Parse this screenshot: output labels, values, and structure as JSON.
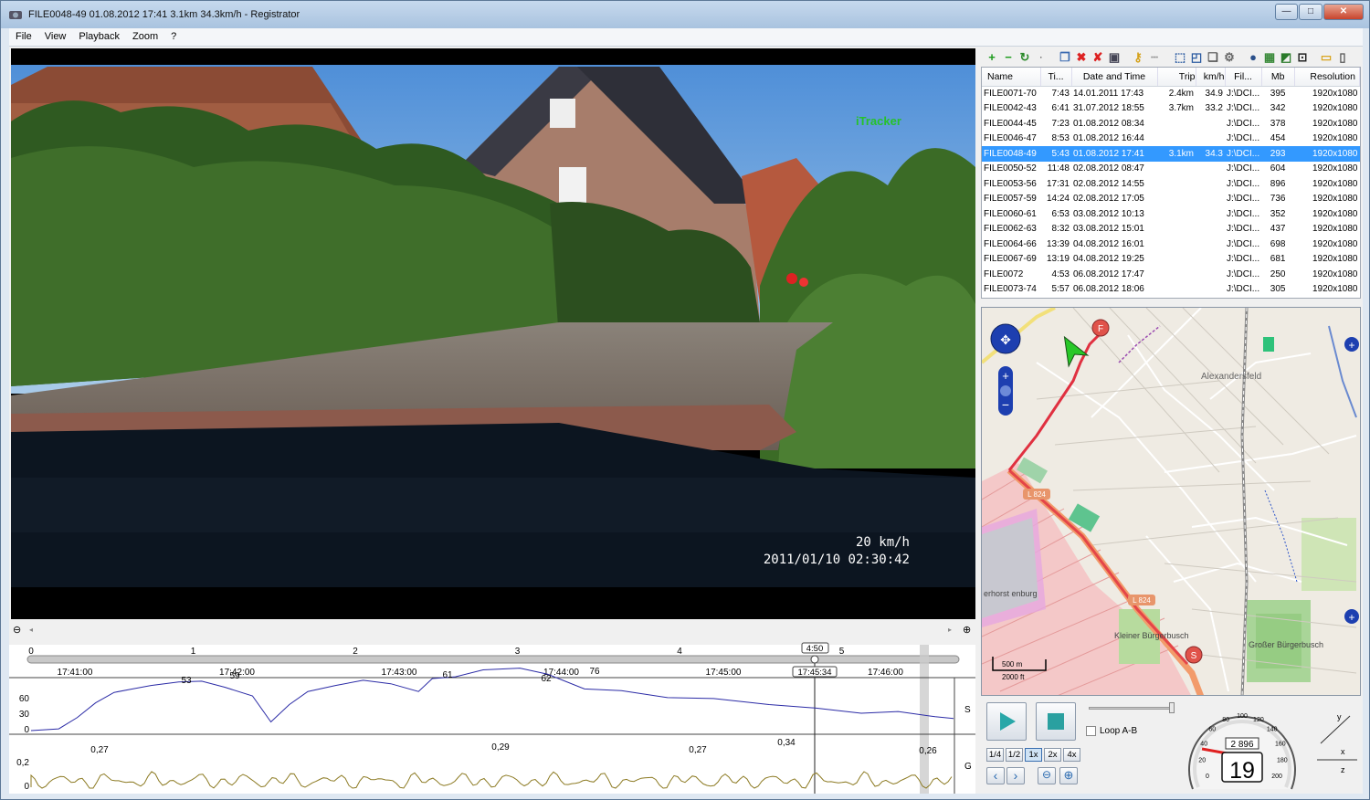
{
  "window": {
    "title": "FILE0048-49     01.08.2012 17:41     3.1km     34.3km/h - Registrator"
  },
  "menu": [
    "File",
    "View",
    "Playback",
    "Zoom",
    "?"
  ],
  "video": {
    "watermark": "iTracker",
    "speed_overlay": "20 km/h",
    "datetime_overlay": "2011/01/10 02:30:42"
  },
  "file_list": {
    "columns": [
      "Name",
      "Ti...",
      "Date and Time",
      "Trip",
      "km/h",
      "Fil...",
      "Mb",
      "Resolution"
    ],
    "rows": [
      {
        "name": "FILE0071-70",
        "time": "7:43",
        "datetime": "14.01.2011 17:43",
        "trip": "2.4km",
        "kmh": "34.9",
        "file": "J:\\DCI...",
        "mb": "395",
        "res": "1920x1080"
      },
      {
        "name": "FILE0042-43",
        "time": "6:41",
        "datetime": "31.07.2012 18:55",
        "trip": "3.7km",
        "kmh": "33.2",
        "file": "J:\\DCI...",
        "mb": "342",
        "res": "1920x1080"
      },
      {
        "name": "FILE0044-45",
        "time": "7:23",
        "datetime": "01.08.2012 08:34",
        "trip": "",
        "kmh": "",
        "file": "J:\\DCI...",
        "mb": "378",
        "res": "1920x1080"
      },
      {
        "name": "FILE0046-47",
        "time": "8:53",
        "datetime": "01.08.2012 16:44",
        "trip": "",
        "kmh": "",
        "file": "J:\\DCI...",
        "mb": "454",
        "res": "1920x1080"
      },
      {
        "name": "FILE0048-49",
        "time": "5:43",
        "datetime": "01.08.2012 17:41",
        "trip": "3.1km",
        "kmh": "34.3",
        "file": "J:\\DCI...",
        "mb": "293",
        "res": "1920x1080",
        "selected": true
      },
      {
        "name": "FILE0050-52",
        "time": "11:48",
        "datetime": "02.08.2012 08:47",
        "trip": "",
        "kmh": "",
        "file": "J:\\DCI...",
        "mb": "604",
        "res": "1920x1080"
      },
      {
        "name": "FILE0053-56",
        "time": "17:31",
        "datetime": "02.08.2012 14:55",
        "trip": "",
        "kmh": "",
        "file": "J:\\DCI...",
        "mb": "896",
        "res": "1920x1080"
      },
      {
        "name": "FILE0057-59",
        "time": "14:24",
        "datetime": "02.08.2012 17:05",
        "trip": "",
        "kmh": "",
        "file": "J:\\DCI...",
        "mb": "736",
        "res": "1920x1080"
      },
      {
        "name": "FILE0060-61",
        "time": "6:53",
        "datetime": "03.08.2012 10:13",
        "trip": "",
        "kmh": "",
        "file": "J:\\DCI...",
        "mb": "352",
        "res": "1920x1080"
      },
      {
        "name": "FILE0062-63",
        "time": "8:32",
        "datetime": "03.08.2012 15:01",
        "trip": "",
        "kmh": "",
        "file": "J:\\DCI...",
        "mb": "437",
        "res": "1920x1080"
      },
      {
        "name": "FILE0064-66",
        "time": "13:39",
        "datetime": "04.08.2012 16:01",
        "trip": "",
        "kmh": "",
        "file": "J:\\DCI...",
        "mb": "698",
        "res": "1920x1080"
      },
      {
        "name": "FILE0067-69",
        "time": "13:19",
        "datetime": "04.08.2012 19:25",
        "trip": "",
        "kmh": "",
        "file": "J:\\DCI...",
        "mb": "681",
        "res": "1920x1080"
      },
      {
        "name": "FILE0072",
        "time": "4:53",
        "datetime": "06.08.2012 17:47",
        "trip": "",
        "kmh": "",
        "file": "J:\\DCI...",
        "mb": "250",
        "res": "1920x1080"
      },
      {
        "name": "FILE0073-74",
        "time": "5:57",
        "datetime": "06.08.2012 18:06",
        "trip": "",
        "kmh": "",
        "file": "J:\\DCI...",
        "mb": "305",
        "res": "1920x1080"
      }
    ]
  },
  "map": {
    "labels": [
      "Alexandersfeld",
      "Kleiner Bürgerbusch",
      "Großer Bürgerbusch",
      "erhorst enburg",
      "L 824",
      "L 824"
    ],
    "scale_m": "500 m",
    "scale_ft": "2000 ft",
    "marker_start": "S",
    "marker_finish": "F"
  },
  "controls": {
    "loop_label": "Loop A-B",
    "speeds": [
      "1/4",
      "1/2",
      "1x",
      "2x",
      "4x"
    ],
    "active_speed": "1x"
  },
  "gauge": {
    "ticks": [
      "0",
      "20",
      "40",
      "60",
      "80",
      "100",
      "120",
      "140",
      "160",
      "180",
      "200"
    ],
    "odometer": "2 896",
    "speed": "19"
  },
  "timeline": {
    "minutes": [
      "0",
      "1",
      "2",
      "3",
      "4",
      "5"
    ],
    "times": [
      "17:41:00",
      "17:42:00",
      "17:43:00",
      "17:44:00",
      "17:45:00",
      "17:46:00"
    ],
    "cursor_label": "4:50",
    "cursor_time": "17:45:34",
    "speed_axis": [
      "60",
      "30",
      "0"
    ],
    "speed_channel": "S",
    "g_axis": [
      "0,2",
      "0"
    ],
    "g_channel": "G",
    "speed_peaks": [
      "53",
      "59",
      "61",
      "62",
      "76"
    ],
    "g_peaks": [
      "0,27",
      "0,29",
      "0,27",
      "0,34",
      "0,26"
    ]
  },
  "colors": {
    "selection": "#3399ff",
    "speed_line": "#2b2ba6",
    "g_line": "#8c7a22",
    "route": "#e03040"
  }
}
